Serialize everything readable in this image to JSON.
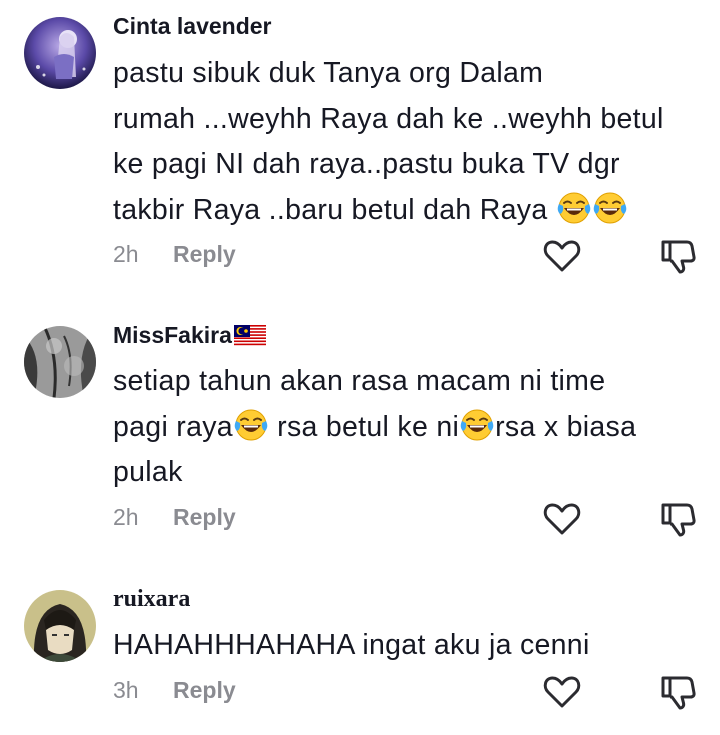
{
  "comments": [
    {
      "username": "Cinta lavender",
      "lines": [
        "pastu sibuk duk Tanya org Dalam",
        "rumah ...weyhh Raya dah ke ..weyhh betul",
        "ke pagi NI dah raya..pastu buka TV dgr",
        "takbir Raya ..baru betul dah Raya "
      ],
      "time": "2h",
      "reply_label": "Reply"
    },
    {
      "username": "MissFakira",
      "lines": [
        "setiap tahun akan rasa macam ni time",
        "pagi raya",
        " rsa betul ke ni",
        "rsa x biasa",
        "pulak"
      ],
      "time": "2h",
      "reply_label": "Reply"
    },
    {
      "username": "ruixara",
      "lines": [
        "HAHAHHHAHAHA ingat aku ja cenni"
      ],
      "time": "3h",
      "reply_label": "Reply"
    }
  ],
  "icons": {
    "emoji": "face-with-tears-of-joy-icon",
    "flag": "malaysia-flag-icon",
    "like": "heart-outline-icon",
    "dislike": "thumbs-down-outline-icon"
  },
  "colors": {
    "text": "#161823",
    "meta": "#8a8b91",
    "icon": "#1f1f25"
  }
}
